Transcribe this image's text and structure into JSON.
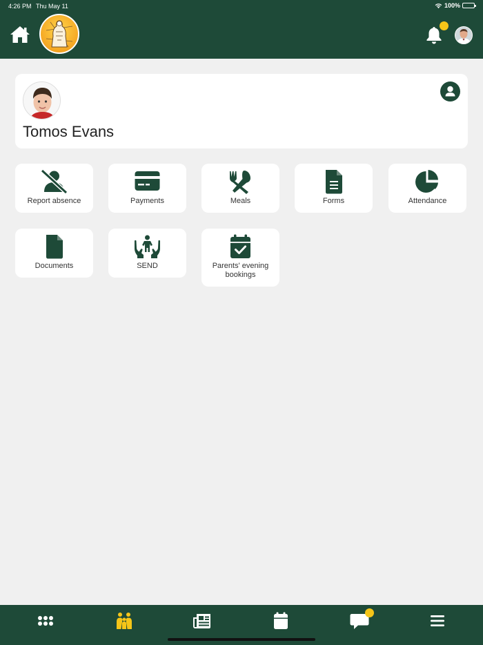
{
  "status_bar": {
    "time": "4:26 PM",
    "date": "Thu May 11",
    "battery": "100%"
  },
  "header": {
    "home_icon": "home-icon",
    "notification_icon": "bell-icon",
    "has_notification": true
  },
  "child": {
    "name": "Tomos Evans"
  },
  "tiles": [
    {
      "label": "Report absence",
      "icon": "user-slash-icon"
    },
    {
      "label": "Payments",
      "icon": "credit-card-icon"
    },
    {
      "label": "Meals",
      "icon": "utensils-icon"
    },
    {
      "label": "Forms",
      "icon": "file-lines-icon"
    },
    {
      "label": "Attendance",
      "icon": "pie-chart-icon"
    },
    {
      "label": "Documents",
      "icon": "file-icon"
    },
    {
      "label": "SEND",
      "icon": "hands-child-icon"
    },
    {
      "label": "Parents' evening bookings",
      "icon": "calendar-check-icon"
    }
  ],
  "bottom_nav": [
    {
      "icon": "grid-icon",
      "active": false
    },
    {
      "icon": "family-icon",
      "active": true
    },
    {
      "icon": "newspaper-icon",
      "active": false
    },
    {
      "icon": "calendar-icon",
      "active": false
    },
    {
      "icon": "chat-icon",
      "active": false,
      "badge": true
    },
    {
      "icon": "menu-icon",
      "active": false
    }
  ],
  "colors": {
    "primary": "#1e4a38",
    "accent": "#f5c518",
    "background": "#f0f0f0"
  }
}
